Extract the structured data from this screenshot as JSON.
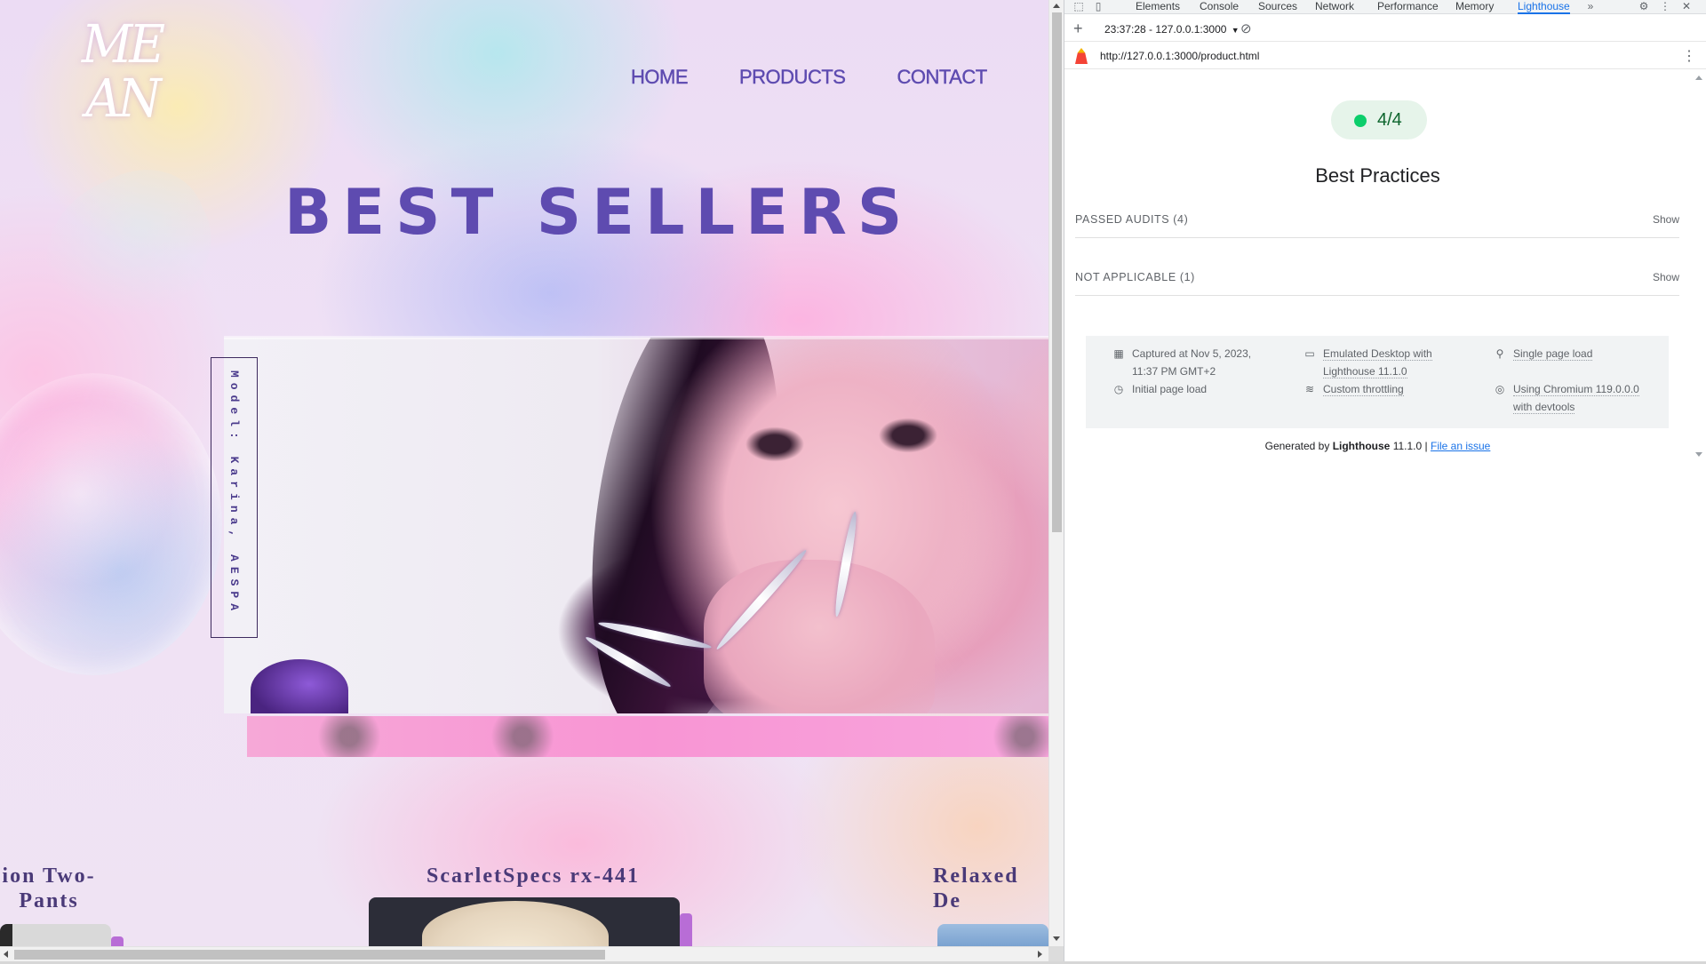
{
  "site": {
    "logo_text": "MEAN",
    "nav": [
      "HOME",
      "PRODUCTS",
      "CONTACT"
    ],
    "hero_title": "BEST SELLERS",
    "model_label": "Model: Karina, AESPA",
    "products": [
      {
        "title": "ion Two-\nPants"
      },
      {
        "title": "ScarletSpecs rx-441"
      },
      {
        "title": "Relaxed\nDe"
      }
    ]
  },
  "devtools": {
    "tabs": [
      "Elements",
      "Console",
      "Sources",
      "Network",
      "Performance",
      "Memory",
      "Lighthouse"
    ],
    "active_tab": "Lighthouse",
    "toolbar": {
      "report_select": "23:37:28 - 127.0.0.1:3000"
    },
    "url": "http://127.0.0.1:3000/product.html",
    "report": {
      "score": "4/4",
      "score_color": "#0cce6b",
      "category": "Best Practices",
      "groups": [
        {
          "label": "PASSED AUDITS",
          "count": "(4)",
          "action": "Show"
        },
        {
          "label": "NOT APPLICABLE",
          "count": "(1)",
          "action": "Show"
        }
      ],
      "meta": {
        "captured_line1": "Captured at Nov 5, 2023,",
        "captured_line2": "11:37 PM GMT+2",
        "initial": "Initial page load",
        "emulated_line1": "Emulated Desktop with",
        "emulated_line2": "Lighthouse 11.1.0",
        "throttling": "Custom throttling",
        "single": "Single page load",
        "chromium_line1": "Using Chromium 119.0.0.0",
        "chromium_line2": "with devtools"
      },
      "footer": {
        "generated_by": "Generated by",
        "tool": "Lighthouse",
        "version": "11.1.0 |",
        "issue_link": "File an issue"
      }
    }
  }
}
